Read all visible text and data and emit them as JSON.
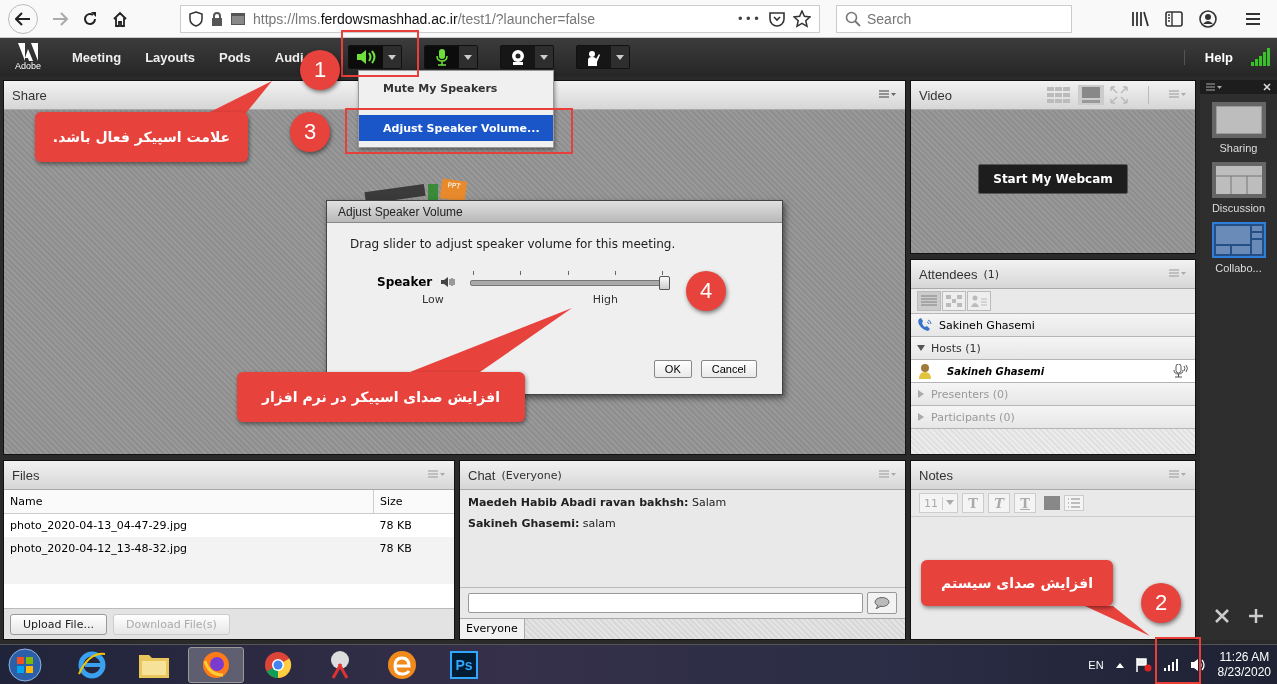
{
  "browser": {
    "url_prefix": "https://lms.",
    "url_domain": "ferdowsmashhad.ac.ir",
    "url_path": "/test1/?launcher=false",
    "more": "•••",
    "search": {
      "placeholder": "Search"
    }
  },
  "menubar": {
    "logo": "Adobe",
    "items": [
      "Meeting",
      "Layouts",
      "Pods",
      "Audi"
    ],
    "tools": [
      {
        "kind": "speaker",
        "on": true
      },
      {
        "kind": "microphone",
        "on": true
      },
      {
        "kind": "webcam",
        "on": false
      },
      {
        "kind": "hand",
        "on": false
      }
    ],
    "help": "Help"
  },
  "speaker_menu": {
    "items": [
      {
        "label": "Mute My Speakers",
        "selected": false
      },
      {
        "label": "Adjust Speaker Volume...",
        "selected": true
      }
    ]
  },
  "share": {
    "title": "Share",
    "icon_label": "PPT"
  },
  "dialog": {
    "title": "Adjust Speaker Volume",
    "message": "Drag slider to adjust speaker volume for this meeting.",
    "label": "Speaker",
    "level": 1,
    "low": "Low",
    "high": "High",
    "buttons": [
      "OK",
      "Cancel"
    ]
  },
  "video": {
    "title": "Video",
    "button": "Start My Webcam"
  },
  "attendees": {
    "title": "Attendees",
    "count": "(1)",
    "caller": "Sakineh Ghasemi",
    "groups": [
      {
        "label": "Hosts (1)",
        "expanded": true,
        "children": [
          {
            "name": "Sakineh Ghasemi"
          }
        ]
      },
      {
        "label": "Presenters (0)",
        "expanded": false
      },
      {
        "label": "Participants (0)",
        "expanded": false
      }
    ]
  },
  "files": {
    "title": "Files",
    "columns": [
      "Name",
      "Size"
    ],
    "rows": [
      [
        "photo_2020-04-13_04-47-29.jpg",
        "78 KB"
      ],
      [
        "photo_2020-04-12_13-48-32.jpg",
        "78 KB"
      ]
    ],
    "buttons": [
      {
        "label": "Upload File...",
        "disabled": false
      },
      {
        "label": "Download File(s)",
        "disabled": true
      }
    ]
  },
  "chat": {
    "title": "Chat",
    "audience": "(Everyone)",
    "messages": [
      "**Maedeh Habib Abadi ravan bakhsh:** Salam",
      "**Sakineh Ghasemi:** salam"
    ],
    "tabs": [
      {
        "label": "Everyone",
        "selected": true
      }
    ]
  },
  "notes": {
    "title": "Notes",
    "font_size": "11",
    "format_buttons": [
      "T",
      "T",
      "T"
    ]
  },
  "layouts": {
    "items": [
      {
        "label": "Sharing",
        "selected": false
      },
      {
        "label": "Discussion",
        "selected": false
      },
      {
        "label": "Collabo...",
        "selected": true
      }
    ]
  },
  "taskbar": {
    "apps": [
      {
        "kind": "ie",
        "active": false
      },
      {
        "kind": "folder",
        "active": false
      },
      {
        "kind": "firefox",
        "active": true
      },
      {
        "kind": "chrome",
        "active": false
      },
      {
        "kind": "scissors",
        "active": false
      },
      {
        "kind": "orange-e",
        "active": false
      },
      {
        "kind": "photoshop",
        "active": false,
        "label": "Ps"
      }
    ],
    "language": "EN",
    "time": "11:26 AM",
    "date": "8/23/2020"
  },
  "annotations": {
    "badges": [
      "1",
      "2",
      "3",
      "4"
    ],
    "callouts": [
      "علامت اسپیکر فعال باشد.",
      "افزایش صدای سیستم",
      "افزایش صدای اسپیکر در نرم افزار"
    ]
  }
}
